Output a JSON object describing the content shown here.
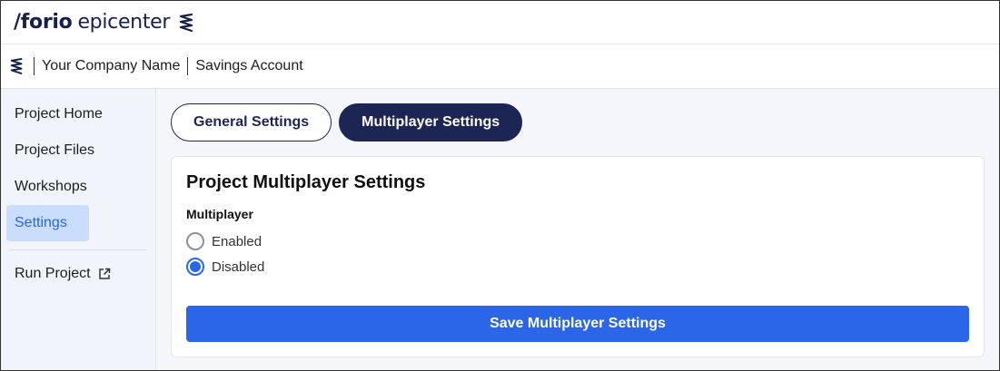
{
  "brand": {
    "slash_word": "/forio",
    "epicenter": "epicenter"
  },
  "breadcrumb": {
    "company": "Your Company Name",
    "project": "Savings Account"
  },
  "sidebar": {
    "items": [
      {
        "label": "Project Home"
      },
      {
        "label": "Project Files"
      },
      {
        "label": "Workshops"
      },
      {
        "label": "Settings",
        "active": true
      }
    ],
    "run_project": "Run Project"
  },
  "tabs": [
    {
      "label": "General Settings",
      "active": false
    },
    {
      "label": "Multiplayer Settings",
      "active": true
    }
  ],
  "card": {
    "title": "Project Multiplayer Settings",
    "field_label": "Multiplayer",
    "options": [
      {
        "label": "Enabled",
        "checked": false
      },
      {
        "label": "Disabled",
        "checked": true
      }
    ],
    "save_label": "Save Multiplayer Settings"
  },
  "colors": {
    "navy": "#1d2555",
    "accent_blue": "#2b65e8",
    "sidebar_bg": "#f1f5fb",
    "active_nav_bg": "#c9defb"
  }
}
